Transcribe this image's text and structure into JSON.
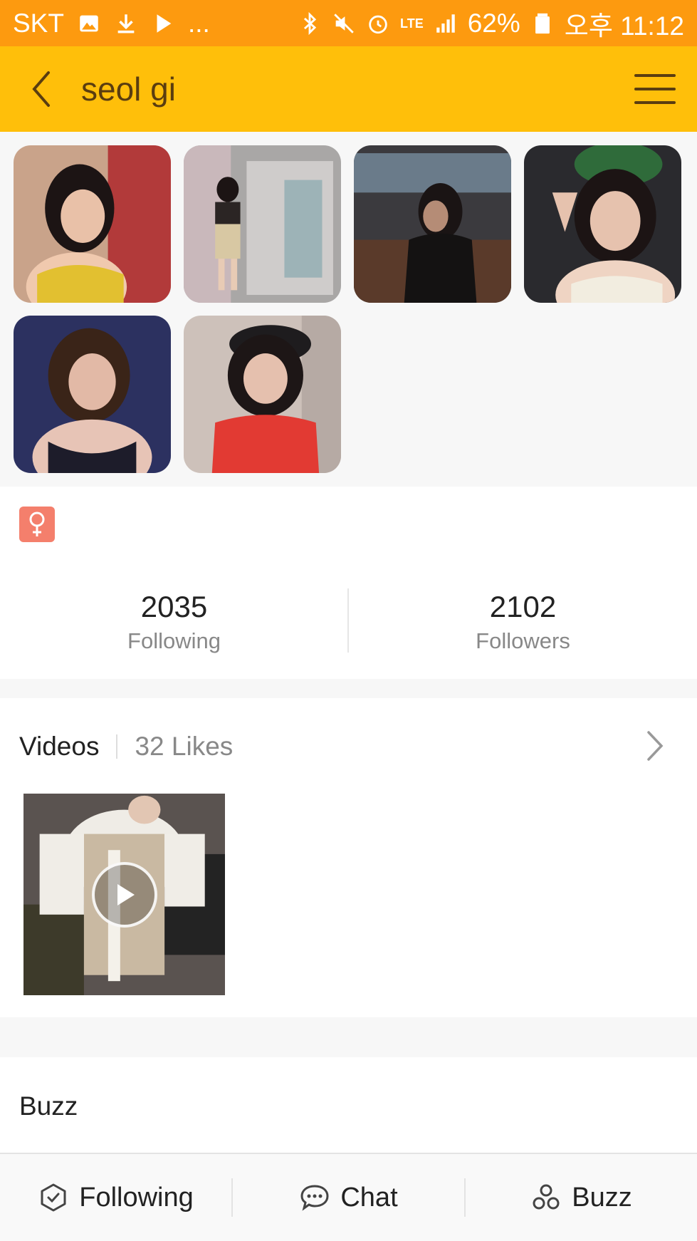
{
  "status_bar": {
    "carrier": "SKT",
    "dots": "...",
    "network": "LTE",
    "battery": "62%",
    "time": "오후 11:12"
  },
  "app_bar": {
    "title": "seol gi"
  },
  "photos": [
    {
      "name": "photo-1"
    },
    {
      "name": "photo-2"
    },
    {
      "name": "photo-3"
    },
    {
      "name": "photo-4"
    },
    {
      "name": "photo-5"
    },
    {
      "name": "photo-6"
    }
  ],
  "profile": {
    "gender_icon": "female-icon",
    "following_count": "2035",
    "following_label": "Following",
    "followers_count": "2102",
    "followers_label": "Followers"
  },
  "videos": {
    "title": "Videos",
    "likes": "32 Likes"
  },
  "buzz": {
    "title": "Buzz"
  },
  "bottom_bar": {
    "following_label": "Following",
    "chat_label": "Chat",
    "buzz_label": "Buzz"
  },
  "colors": {
    "status_bar": "#fd9a0f",
    "app_bar": "#ffbf0a",
    "gender_badge": "#f47f6c"
  }
}
